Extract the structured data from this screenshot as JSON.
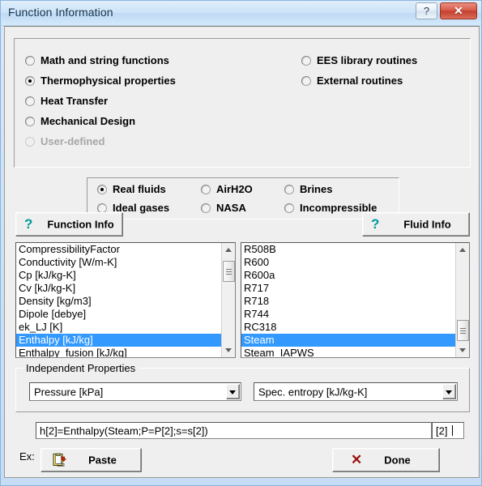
{
  "window": {
    "title": "Function Information",
    "help_button": "?",
    "close_button": "✕"
  },
  "category_radios": {
    "left": [
      {
        "label": "Math and string functions",
        "checked": false,
        "disabled": false
      },
      {
        "label": "Thermophysical properties",
        "checked": true,
        "disabled": false
      },
      {
        "label": "Heat Transfer",
        "checked": false,
        "disabled": false
      },
      {
        "label": "Mechanical Design",
        "checked": false,
        "disabled": false
      },
      {
        "label": "User-defined",
        "checked": false,
        "disabled": true
      }
    ],
    "right": [
      {
        "label": "EES library routines",
        "checked": false,
        "disabled": false
      },
      {
        "label": "External routines",
        "checked": false,
        "disabled": false
      }
    ]
  },
  "fluid_radios": [
    {
      "label": "Real fluids",
      "checked": true,
      "col": 0,
      "row": 0
    },
    {
      "label": "AirH2O",
      "checked": false,
      "col": 1,
      "row": 0
    },
    {
      "label": "Brines",
      "checked": false,
      "col": 2,
      "row": 0
    },
    {
      "label": "Ideal gases",
      "checked": false,
      "col": 0,
      "row": 1
    },
    {
      "label": "NASA",
      "checked": false,
      "col": 1,
      "row": 1
    },
    {
      "label": "Incompressible",
      "checked": false,
      "col": 2,
      "row": 1
    }
  ],
  "info_buttons": {
    "function_info": "Function Info",
    "fluid_info": "Fluid Info",
    "qmark": "?"
  },
  "property_list": {
    "items": [
      "CompressibilityFactor",
      "Conductivity [W/m-K]",
      "Cp [kJ/kg-K]",
      "Cv [kJ/kg-K]",
      "Density [kg/m3]",
      "Dipole [debye]",
      "ek_LJ [K]",
      "Enthalpy [kJ/kg]",
      "Enthalpy_fusion [kJ/kg]"
    ],
    "selected": "Enthalpy [kJ/kg]"
  },
  "fluid_list": {
    "items": [
      "R508B",
      "R600",
      "R600a",
      "R717",
      "R718",
      "R744",
      "RC318",
      "Steam",
      "Steam_IAPWS"
    ],
    "selected": "Steam"
  },
  "independent_properties": {
    "title": "Independent Properties",
    "first": {
      "value": "Pressure [kPa]"
    },
    "second": {
      "value": "Spec. entropy [kJ/kg-K]"
    }
  },
  "example": {
    "label": "Ex:",
    "expression": "h[2]=Enthalpy(Steam;P=P[2];s=s[2])",
    "index": "[2]"
  },
  "actions": {
    "paste": "Paste",
    "done": "Done"
  },
  "colors": {
    "selection": "#3399ff",
    "qmark": "#009a9a",
    "close": "#c4402e",
    "done_x": "#9c1010"
  }
}
